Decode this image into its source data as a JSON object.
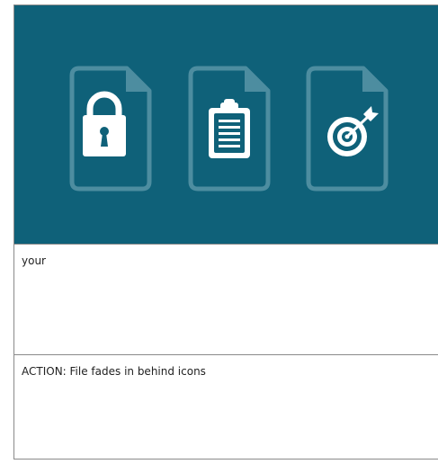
{
  "slide": {
    "background_color": "#0f6179",
    "icons": [
      {
        "name": "lock-icon"
      },
      {
        "name": "clipboard-icon"
      },
      {
        "name": "target-icon"
      }
    ]
  },
  "notes": {
    "script_text": "your",
    "action_text": "ACTION: File fades in behind icons"
  }
}
